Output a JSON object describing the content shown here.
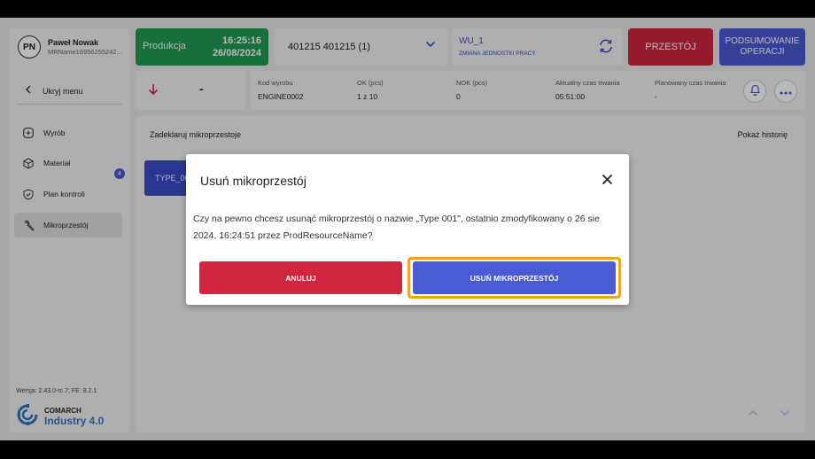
{
  "user": {
    "initials": "PN",
    "name": "Paweł Nowak",
    "sub": "MRName16956255242..."
  },
  "sidebar": {
    "hide_menu": "Ukryj menu",
    "items": [
      {
        "label": "Wyrób",
        "icon": "plus-square-icon"
      },
      {
        "label": "Materiał",
        "icon": "cube-icon"
      },
      {
        "label": "Plan kontroli",
        "icon": "shield-check-icon",
        "badge": "4"
      },
      {
        "label": "Mikroprzestój",
        "icon": "wrench-icon",
        "active": true
      }
    ],
    "version": "Wersja: 2.43.0-rc.7; FE: 8.2.1",
    "logo_top": "COMARCH",
    "logo_bottom": "Industry 4.0"
  },
  "topbar": {
    "status_label": "Produkcja",
    "time": "16:25:16",
    "date": "26/08/2024",
    "order": "401215 401215  (1)",
    "wu_title": "WU_1",
    "wu_sub": "ZMIANA JEDNOSTKI PRACY",
    "stop_label": "PRZESTÓJ",
    "summary_label": "PODSUMOWANIE OPERACJI"
  },
  "info": {
    "arrow_value": "-",
    "columns": [
      {
        "label": "Kod wyrobu",
        "value": "ENGINE0002"
      },
      {
        "label": "OK (pcs)",
        "value": "1 z 10"
      },
      {
        "label": "NOK (pcs)",
        "value": "0"
      },
      {
        "label": "Aktualny czas trwania",
        "value": "05:51:00"
      },
      {
        "label": "Planowany czas trwania",
        "value": "-"
      }
    ]
  },
  "main": {
    "title": "Zadeklaruj mikroprzestoje",
    "history_link": "Pokaż historię",
    "tile": "TYPE_001"
  },
  "modal": {
    "title": "Usuń mikroprzestój",
    "text": "Czy na pewno chcesz usunąć mikroprzestój o nazwie „Type 001\", ostatnio zmodyfikowany o 26 sie 2024, 16:24:51 przez ProdResourceName?",
    "cancel": "ANULUJ",
    "confirm": "USUŃ MIKROPRZESTÓJ"
  },
  "colors": {
    "production_green": "#219a52",
    "danger_red": "#d12640",
    "primary_blue": "#4a5bd4",
    "focus_orange": "#f5a11c"
  }
}
